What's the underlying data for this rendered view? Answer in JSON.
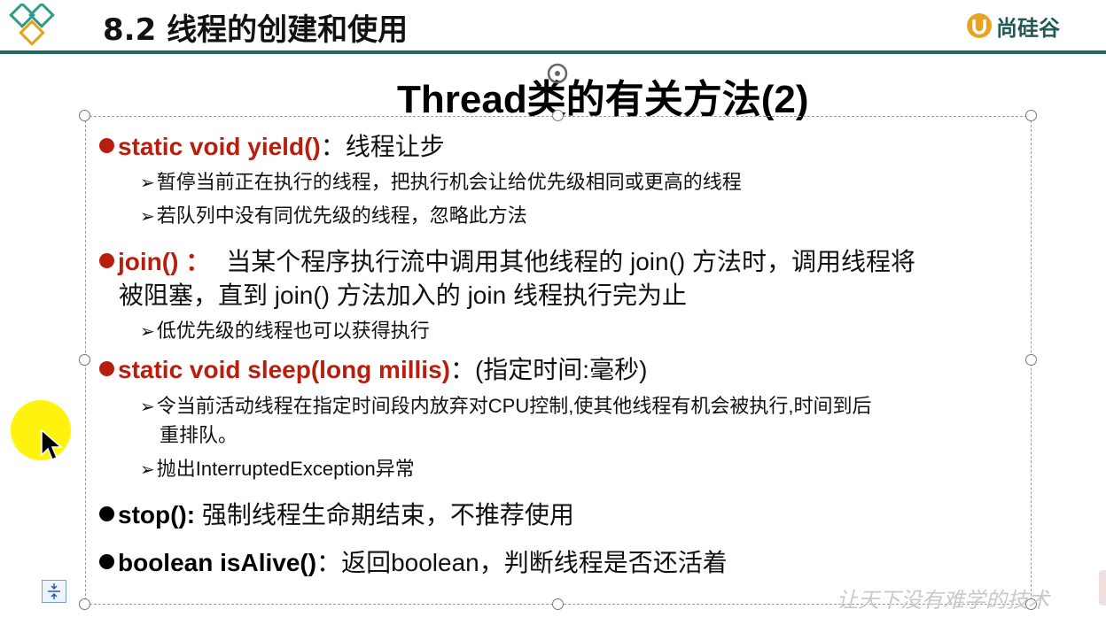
{
  "header": {
    "section_title": "8.2 线程的创建和使用",
    "brand_name": "尚硅谷",
    "rule_color": "#1f6b5e"
  },
  "slide": {
    "title": "Thread类的有关方法(2)",
    "items": [
      {
        "signature": "static  void  yield()",
        "sep": "：",
        "desc": "线程让步",
        "signature_color": "#b81e0e",
        "subs": [
          "暂停当前正在执行的线程，把执行机会让给优先级相同或更高的线程",
          "若队列中没有同优先级的线程，忽略此方法"
        ]
      },
      {
        "signature": "join()",
        "sep": " ：",
        "desc": "当某个程序执行流中调用其他线程的 join() 方法时，调用线程将",
        "desc_line2": "被阻塞，直到 join() 方法加入的 join 线程执行完为止",
        "signature_color": "#b81e0e",
        "subs": [
          "低优先级的线程也可以获得执行"
        ]
      },
      {
        "signature": "static  void  sleep(long millis)",
        "sep": "：",
        "desc": "(指定时间:毫秒)",
        "signature_color": "#b81e0e",
        "subs": [
          "令当前活动线程在指定时间段内放弃对CPU控制,使其他线程有机会被执行,时间到后",
          "重排队。",
          "抛出InterruptedException异常"
        ]
      },
      {
        "signature": "stop()",
        "sep": ":",
        "desc": " 强制线程生命期结束，不推荐使用",
        "signature_color": "#000000",
        "subs": []
      },
      {
        "signature": "boolean isAlive()",
        "sep": "：",
        "desc": "返回boolean，判断线程是否还活着",
        "signature_color": "#000000",
        "subs": []
      }
    ]
  },
  "watermark": "让天下没有难学的技术",
  "icons": {
    "logo": "diamond-logo-icon",
    "brand": "brand-u-icon",
    "pointer": "mouse-pointer-icon",
    "notes": "notes-icon"
  }
}
